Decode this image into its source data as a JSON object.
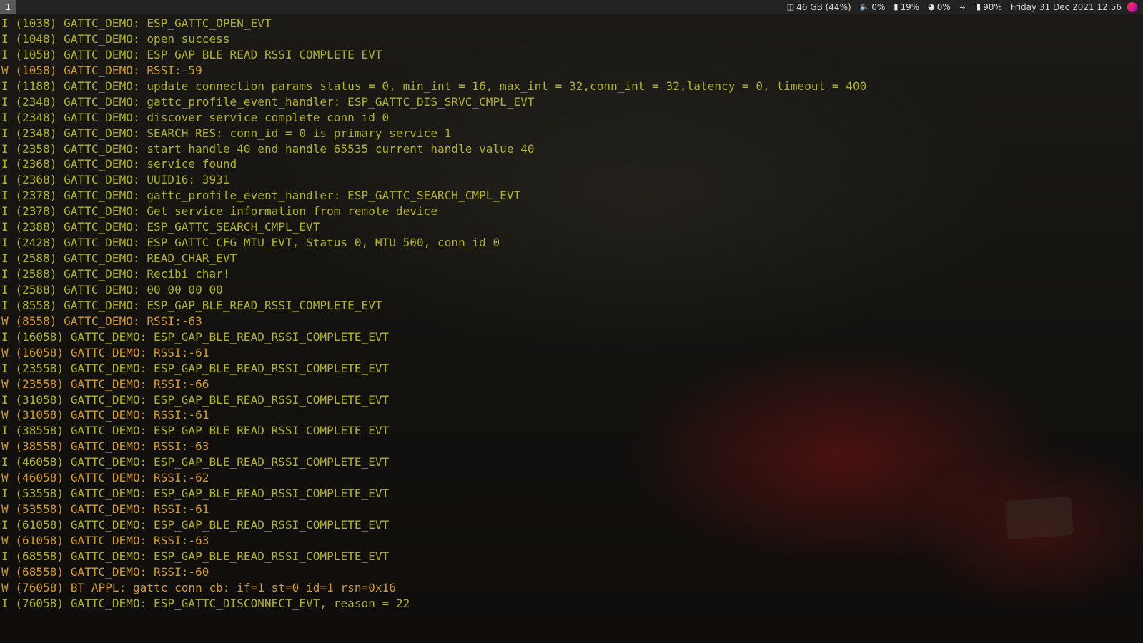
{
  "topbar": {
    "workspace": "1",
    "disk": "46 GB (44%)",
    "volume": "0%",
    "memory": "19%",
    "cpu": "0%",
    "battery": "90%",
    "datetime": "Friday 31 Dec 2021 12:56"
  },
  "colors": {
    "info": "#b2b22a",
    "warning": "#d39a2e",
    "topbar_bg": "#222222"
  },
  "terminal": {
    "lines": [
      {
        "level": "I",
        "text": "I (1038) GATTC_DEMO: ESP_GATTC_OPEN_EVT"
      },
      {
        "level": "I",
        "text": "I (1048) GATTC_DEMO: open success"
      },
      {
        "level": "I",
        "text": "I (1058) GATTC_DEMO: ESP_GAP_BLE_READ_RSSI_COMPLETE_EVT"
      },
      {
        "level": "W",
        "text": "W (1058) GATTC_DEMO: RSSI:-59"
      },
      {
        "level": "I",
        "text": "I (1188) GATTC_DEMO: update connection params status = 0, min_int = 16, max_int = 32,conn_int = 32,latency = 0, timeout = 400"
      },
      {
        "level": "I",
        "text": "I (2348) GATTC_DEMO: gattc_profile_event_handler: ESP_GATTC_DIS_SRVC_CMPL_EVT"
      },
      {
        "level": "I",
        "text": "I (2348) GATTC_DEMO: discover service complete conn_id 0"
      },
      {
        "level": "I",
        "text": "I (2348) GATTC_DEMO: SEARCH RES: conn_id = 0 is primary service 1"
      },
      {
        "level": "I",
        "text": "I (2358) GATTC_DEMO: start handle 40 end handle 65535 current handle value 40"
      },
      {
        "level": "I",
        "text": "I (2368) GATTC_DEMO: service found"
      },
      {
        "level": "I",
        "text": "I (2368) GATTC_DEMO: UUID16: 3931"
      },
      {
        "level": "I",
        "text": "I (2378) GATTC_DEMO: gattc_profile_event_handler: ESP_GATTC_SEARCH_CMPL_EVT"
      },
      {
        "level": "I",
        "text": "I (2378) GATTC_DEMO: Get service information from remote device"
      },
      {
        "level": "I",
        "text": "I (2388) GATTC_DEMO: ESP_GATTC_SEARCH_CMPL_EVT"
      },
      {
        "level": "I",
        "text": "I (2428) GATTC_DEMO: ESP_GATTC_CFG_MTU_EVT, Status 0, MTU 500, conn_id 0"
      },
      {
        "level": "I",
        "text": "I (2588) GATTC_DEMO: READ_CHAR_EVT"
      },
      {
        "level": "I",
        "text": "I (2588) GATTC_DEMO: Recibí char!"
      },
      {
        "level": "I",
        "text": "I (2588) GATTC_DEMO: 00 00 00 00"
      },
      {
        "level": "I",
        "text": "I (8558) GATTC_DEMO: ESP_GAP_BLE_READ_RSSI_COMPLETE_EVT"
      },
      {
        "level": "W",
        "text": "W (8558) GATTC_DEMO: RSSI:-63"
      },
      {
        "level": "I",
        "text": "I (16058) GATTC_DEMO: ESP_GAP_BLE_READ_RSSI_COMPLETE_EVT"
      },
      {
        "level": "W",
        "text": "W (16058) GATTC_DEMO: RSSI:-61"
      },
      {
        "level": "I",
        "text": "I (23558) GATTC_DEMO: ESP_GAP_BLE_READ_RSSI_COMPLETE_EVT"
      },
      {
        "level": "W",
        "text": "W (23558) GATTC_DEMO: RSSI:-66"
      },
      {
        "level": "I",
        "text": "I (31058) GATTC_DEMO: ESP_GAP_BLE_READ_RSSI_COMPLETE_EVT"
      },
      {
        "level": "W",
        "text": "W (31058) GATTC_DEMO: RSSI:-61"
      },
      {
        "level": "I",
        "text": "I (38558) GATTC_DEMO: ESP_GAP_BLE_READ_RSSI_COMPLETE_EVT"
      },
      {
        "level": "W",
        "text": "W (38558) GATTC_DEMO: RSSI:-63"
      },
      {
        "level": "I",
        "text": "I (46058) GATTC_DEMO: ESP_GAP_BLE_READ_RSSI_COMPLETE_EVT"
      },
      {
        "level": "W",
        "text": "W (46058) GATTC_DEMO: RSSI:-62"
      },
      {
        "level": "I",
        "text": "I (53558) GATTC_DEMO: ESP_GAP_BLE_READ_RSSI_COMPLETE_EVT"
      },
      {
        "level": "W",
        "text": "W (53558) GATTC_DEMO: RSSI:-61"
      },
      {
        "level": "I",
        "text": "I (61058) GATTC_DEMO: ESP_GAP_BLE_READ_RSSI_COMPLETE_EVT"
      },
      {
        "level": "W",
        "text": "W (61058) GATTC_DEMO: RSSI:-63"
      },
      {
        "level": "I",
        "text": "I (68558) GATTC_DEMO: ESP_GAP_BLE_READ_RSSI_COMPLETE_EVT"
      },
      {
        "level": "W",
        "text": "W (68558) GATTC_DEMO: RSSI:-60"
      },
      {
        "level": "W",
        "text": "W (76058) BT_APPL: gattc_conn_cb: if=1 st=0 id=1 rsn=0x16"
      },
      {
        "level": "I",
        "text": "I (76058) GATTC_DEMO: ESP_GATTC_DISCONNECT_EVT, reason = 22"
      }
    ]
  }
}
